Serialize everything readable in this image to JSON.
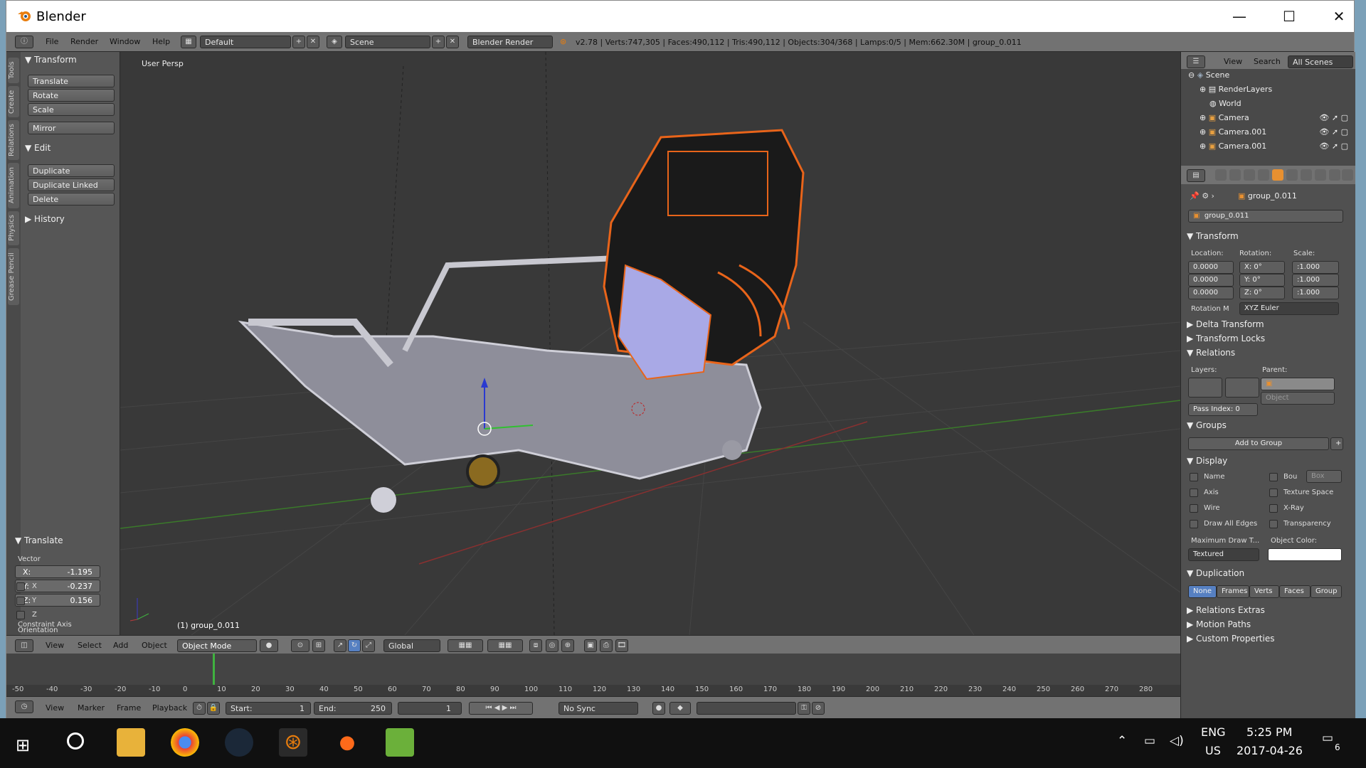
{
  "app": {
    "title": "Blender"
  },
  "menu": {
    "items": [
      "File",
      "Render",
      "Window",
      "Help"
    ],
    "layout": "Default",
    "scene": "Scene",
    "engine": "Blender Render",
    "stats": "v2.78 | Verts:747,305 | Faces:490,112 | Tris:490,112 | Objects:304/368 | Lamps:0/5 | Mem:662.30M | group_0.011"
  },
  "toolshelf": {
    "tabs": [
      "Tools",
      "Create",
      "Relations",
      "Animation",
      "Physics",
      "Grease Pencil"
    ],
    "transform_header": "Transform",
    "transform_buttons": [
      "Translate",
      "Rotate",
      "Scale",
      "Mirror"
    ],
    "edit_header": "Edit",
    "edit_buttons": [
      "Duplicate",
      "Duplicate Linked",
      "Delete"
    ],
    "history_header": "History"
  },
  "operator": {
    "header": "Translate",
    "vector_label": "Vector",
    "x_label": "X:",
    "x": "-1.195",
    "y_label": "Y:",
    "y": "-0.237",
    "z_label": "Z:",
    "z": "0.156",
    "constraint_label": "Constraint Axis",
    "axes": [
      "X",
      "Y",
      "Z"
    ],
    "orientation_label": "Orientation"
  },
  "viewport": {
    "view_name": "User Persp",
    "object_label": "(1) group_0.011"
  },
  "viewport_header": {
    "menus": [
      "View",
      "Select",
      "Add",
      "Object"
    ],
    "mode": "Object Mode",
    "orientation": "Global"
  },
  "timeline": {
    "ticks": [
      "-50",
      "-40",
      "-30",
      "-20",
      "-10",
      "0",
      "10",
      "20",
      "30",
      "40",
      "50",
      "60",
      "70",
      "80",
      "90",
      "100",
      "110",
      "120",
      "130",
      "140",
      "150",
      "160",
      "170",
      "180",
      "190",
      "200",
      "210",
      "220",
      "230",
      "240",
      "250",
      "260",
      "270",
      "280"
    ],
    "menus": [
      "View",
      "Marker",
      "Frame",
      "Playback"
    ],
    "start_label": "Start:",
    "start": "1",
    "end_label": "End:",
    "end": "250",
    "current": "1",
    "sync": "No Sync"
  },
  "outliner": {
    "menus": [
      "View",
      "Search"
    ],
    "filter": "All Scenes",
    "rows": [
      "Scene",
      "RenderLayers",
      "World",
      "Camera",
      "Camera.001",
      "Camera.001"
    ]
  },
  "properties": {
    "object_path": "group_0.011",
    "object_name": "group_0.011",
    "transform_header": "Transform",
    "location_label": "Location:",
    "rotation_label": "Rotation:",
    "scale_label": "Scale:",
    "location": [
      "0.0000",
      "0.0000",
      "0.0000"
    ],
    "rotation": [
      {
        "axis": "X:",
        "value": "0°"
      },
      {
        "axis": "Y:",
        "value": "0°"
      },
      {
        "axis": "Z:",
        "value": "0°"
      }
    ],
    "scale": [
      ":1.000",
      ":1.000",
      ":1.000"
    ],
    "rotation_mode_label": "Rotation M",
    "rotation_mode": "XYZ Euler",
    "delta_transform": "Delta Transform",
    "transform_locks": "Transform Locks",
    "relations_header": "Relations",
    "layers_label": "Layers:",
    "parent_label": "Parent:",
    "parent_type": "Object",
    "pass_index_label": "Pass Index:",
    "pass_index": "0",
    "groups_header": "Groups",
    "add_to_group": "Add to Group",
    "display_header": "Display",
    "display_left": [
      "Name",
      "Axis",
      "Wire",
      "Draw All Edges"
    ],
    "display_right": [
      "Bou",
      "Texture Space",
      "X-Ray",
      "Transparency"
    ],
    "bounds_type": "Box",
    "max_draw_label": "Maximum Draw T...",
    "object_color_label": "Object Color:",
    "max_draw": "Textured",
    "duplication_header": "Duplication",
    "duplication_options": [
      "None",
      "Frames",
      "Verts",
      "Faces",
      "Group"
    ],
    "relations_extras": "Relations Extras",
    "motion_paths": "Motion Paths",
    "custom_properties": "Custom Properties"
  },
  "taskbar": {
    "lang1": "ENG",
    "lang2": "US",
    "time": "5:25 PM",
    "date": "2017-04-26",
    "notif": "6"
  }
}
